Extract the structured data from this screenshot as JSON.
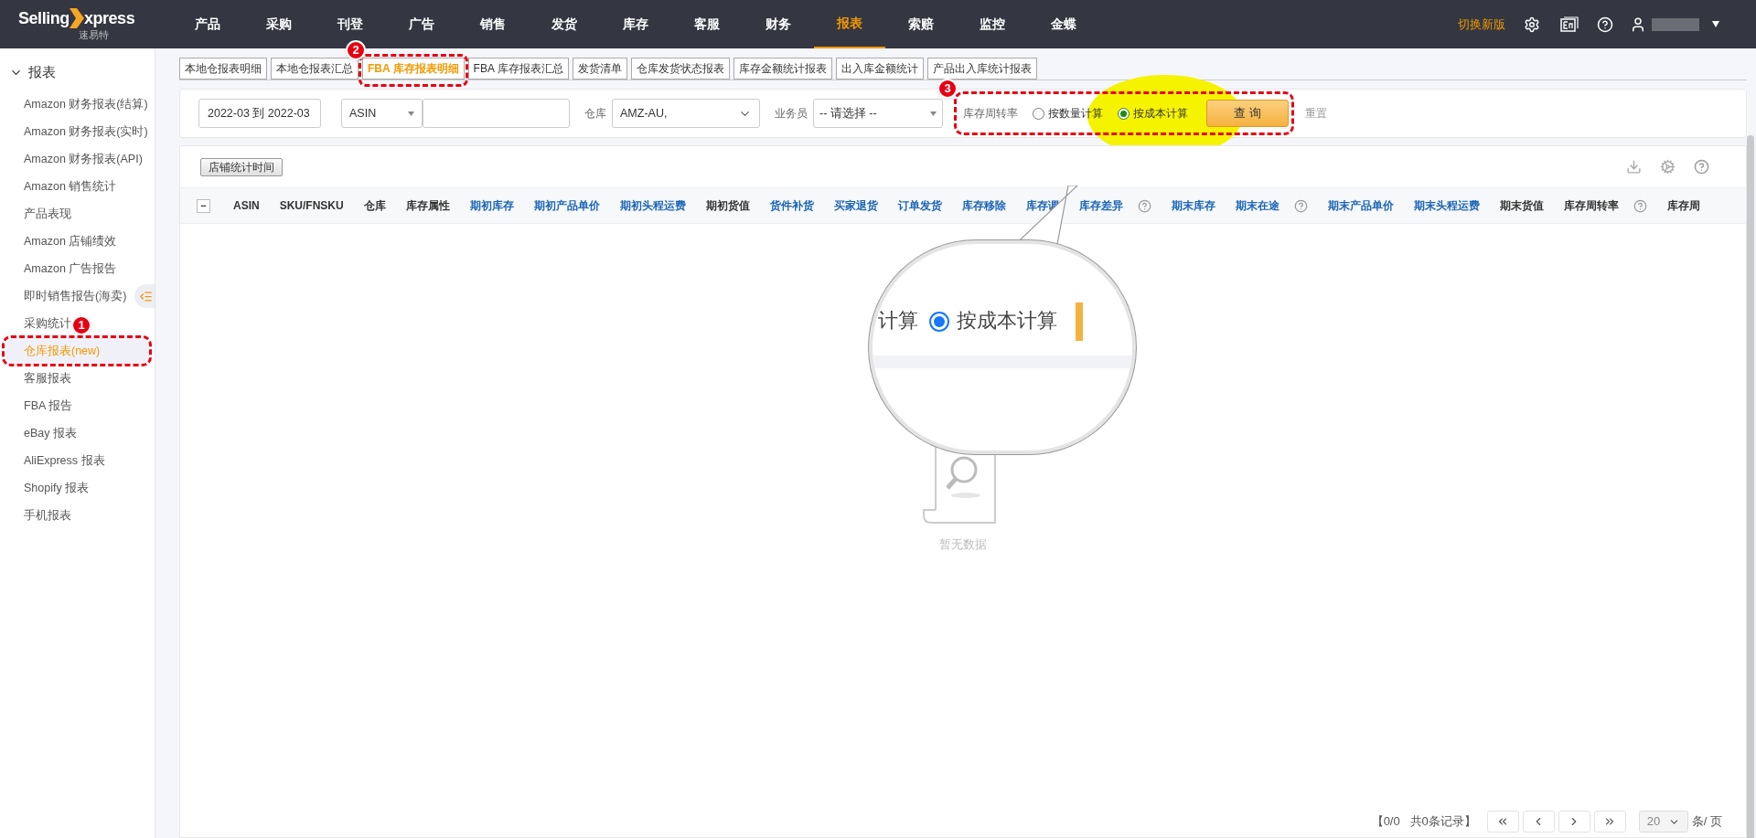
{
  "top_bar": {
    "logo": {
      "text": "Selling",
      "text_2": "xpress",
      "subtitle": "速易特"
    },
    "nav": [
      {
        "label": "产品",
        "selected": false
      },
      {
        "label": "采购",
        "selected": false
      },
      {
        "label": "刊登",
        "selected": false
      },
      {
        "label": "广告",
        "selected": false
      },
      {
        "label": "销售",
        "selected": false
      },
      {
        "label": "发货",
        "selected": false
      },
      {
        "label": "库存",
        "selected": false
      },
      {
        "label": "客服",
        "selected": false
      },
      {
        "label": "财务",
        "selected": false
      },
      {
        "label": "报表",
        "selected": true
      },
      {
        "label": "索赔",
        "selected": false
      },
      {
        "label": "监控",
        "selected": false
      },
      {
        "label": "金蝶",
        "selected": false
      }
    ],
    "switch_version": "切换新版"
  },
  "sidebar": {
    "title": "报表",
    "expanded": true,
    "items": [
      {
        "label": "Amazon 财务报表(结算)",
        "selected": false
      },
      {
        "label": "Amazon 财务报表(实时)",
        "selected": false
      },
      {
        "label": "Amazon 财务报表(API)",
        "selected": false
      },
      {
        "label": "Amazon 销售统计",
        "selected": false
      },
      {
        "label": "产品表现",
        "selected": false
      },
      {
        "label": "Amazon 店铺绩效",
        "selected": false
      },
      {
        "label": "Amazon 广告报告",
        "selected": false
      },
      {
        "label": "即时销售报告(海卖)",
        "selected": false
      },
      {
        "label": "采购统计",
        "selected": false
      },
      {
        "label": "仓库报表(new)",
        "selected": true
      },
      {
        "label": "客服报表",
        "selected": false
      },
      {
        "label": "FBA 报告",
        "selected": false
      },
      {
        "label": "eBay 报表",
        "selected": false
      },
      {
        "label": "AliExpress 报表",
        "selected": false
      },
      {
        "label": "Shopify 报表",
        "selected": false
      },
      {
        "label": "手机报表",
        "selected": false
      }
    ]
  },
  "tabs": [
    {
      "label": "本地仓报表明细",
      "selected": false
    },
    {
      "label": "本地仓报表汇总",
      "selected": false
    },
    {
      "label": "FBA 库存报表明细",
      "selected": true
    },
    {
      "label": "FBA 库存报表汇总",
      "selected": false
    },
    {
      "label": "发货清单",
      "selected": false
    },
    {
      "label": "仓库发货状态报表",
      "selected": false
    },
    {
      "label": "库存金额统计报表",
      "selected": false
    },
    {
      "label": "出入库金额统计",
      "selected": false
    },
    {
      "label": "产品出入库统计报表",
      "selected": false
    }
  ],
  "filters": {
    "date_range": "2022-03 到 2022-03",
    "search_type": "ASIN",
    "warehouse": {
      "label": "仓库",
      "value": "AMZ-AU,"
    },
    "salesperson": {
      "label": "业务员",
      "value": "-- 请选择 --"
    },
    "turnover": {
      "label": "库存周转率",
      "options": [
        {
          "label": "按数量计算",
          "selected": false
        },
        {
          "label": "按成本计算",
          "selected": true
        }
      ]
    },
    "query_button": "查 询",
    "reset_button": "重置"
  },
  "toolbar": {
    "shop_time_button": "店铺统计时间"
  },
  "table": {
    "collapse_toggle": "−",
    "columns": [
      {
        "label": "ASIN",
        "kind": "plain",
        "help": false
      },
      {
        "label": "SKU/FNSKU",
        "kind": "plain",
        "help": false
      },
      {
        "label": "仓库",
        "kind": "plain",
        "help": false
      },
      {
        "label": "库存属性",
        "kind": "plain",
        "help": false
      },
      {
        "label": "期初库存",
        "kind": "link",
        "help": false
      },
      {
        "label": "期初产品单价",
        "kind": "link",
        "help": false
      },
      {
        "label": "期初头程运费",
        "kind": "link",
        "help": false
      },
      {
        "label": "期初货值",
        "kind": "plain",
        "help": false
      },
      {
        "label": "货件补货",
        "kind": "link",
        "help": false
      },
      {
        "label": "买家退货",
        "kind": "link",
        "help": false
      },
      {
        "label": "订单发货",
        "kind": "link",
        "help": false
      },
      {
        "label": "库存移除",
        "kind": "link",
        "help": false
      },
      {
        "label": "库存调",
        "kind": "link",
        "help": false
      },
      {
        "label": "库存差异",
        "kind": "link",
        "help": true
      },
      {
        "label": "期末库存",
        "kind": "link",
        "help": false
      },
      {
        "label": "期末在途",
        "kind": "link",
        "help": true
      },
      {
        "label": "期末产品单价",
        "kind": "link",
        "help": false
      },
      {
        "label": "期末头程运费",
        "kind": "link",
        "help": false
      },
      {
        "label": "期末货值",
        "kind": "plain",
        "help": false
      },
      {
        "label": "库存周转率",
        "kind": "plain",
        "help": true
      },
      {
        "label": "库存周",
        "kind": "plain",
        "help": false
      }
    ],
    "empty_text": "暂无数据"
  },
  "pagination": {
    "summary": "【0/0   共0条记录】",
    "page_size": "20",
    "per_page": "条/ 页"
  },
  "annotations": [
    {
      "label": "1"
    },
    {
      "label": "2"
    },
    {
      "label": "3"
    }
  ],
  "callout": {
    "text": "计算",
    "option": {
      "label": "按成本计算",
      "selected": true
    }
  }
}
